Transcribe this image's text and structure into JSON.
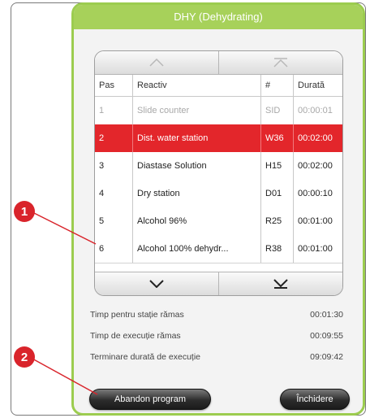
{
  "dialog": {
    "title": "DHY (Dehydrating)"
  },
  "table": {
    "headers": [
      "Pas",
      "Reactiv",
      "#",
      "Durată"
    ],
    "rows": [
      {
        "step": "1",
        "reagent": "Slide counter",
        "code": "SID",
        "duration": "00:00:01",
        "state": "muted"
      },
      {
        "step": "2",
        "reagent": "Dist. water station",
        "code": "W36",
        "duration": "00:02:00",
        "state": "active"
      },
      {
        "step": "3",
        "reagent": "Diastase Solution",
        "code": "H15",
        "duration": "00:02:00",
        "state": "normal"
      },
      {
        "step": "4",
        "reagent": "Dry station",
        "code": "D01",
        "duration": "00:00:10",
        "state": "normal"
      },
      {
        "step": "5",
        "reagent": "Alcohol 96%",
        "code": "R25",
        "duration": "00:01:00",
        "state": "normal"
      },
      {
        "step": "6",
        "reagent": "Alcohol 100% dehydr...",
        "code": "R38",
        "duration": "00:01:00",
        "state": "normal"
      }
    ]
  },
  "info": {
    "remaining_station_label": "Timp pentru stație rămas",
    "remaining_station_value": "00:01:30",
    "remaining_run_label": "Timp de execuție rămas",
    "remaining_run_value": "00:09:55",
    "end_label": "Terminare durată de execuție",
    "end_value": "09:09:42"
  },
  "buttons": {
    "abort": "Abandon program",
    "close": "Închidere"
  },
  "callouts": [
    "1",
    "2"
  ],
  "colors": {
    "title_bar": "#a7d15a",
    "active_row": "#e3262b",
    "callout": "#d9242b"
  }
}
